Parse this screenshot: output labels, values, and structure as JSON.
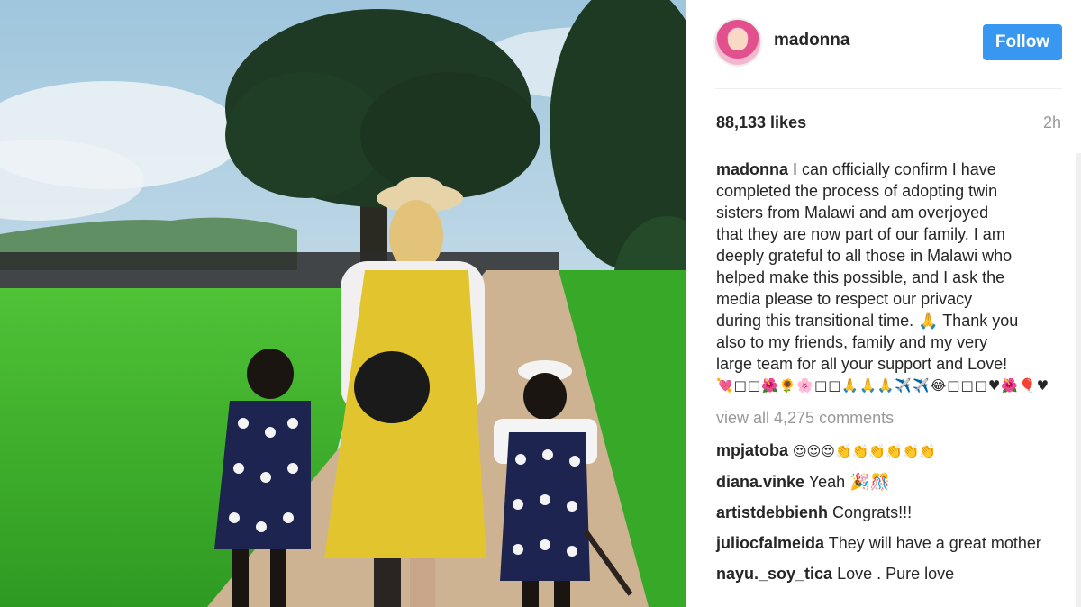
{
  "post": {
    "username": "madonna",
    "follow_label": "Follow",
    "likes": "88,133 likes",
    "time_ago": "2h",
    "caption_user": "madonna",
    "caption_lines": [
      "I can officially confirm I have",
      "completed the process of adopting twin",
      "sisters from Malawi and am overjoyed",
      "that they are now part of our family. I am",
      "deeply grateful to all those in Malawi who",
      "helped make this possible, and I ask the",
      "media please to respect our privacy",
      "during this transitional time. 🙏 Thank you",
      "also to my friends, family and my very",
      "large team for all your support and Love!"
    ],
    "caption_emojis": "💘□□🌺🌻🌸□□🙏🙏🙏✈️✈️😂□□□♥🌺🎈♥",
    "view_all": "view all 4,275 comments"
  },
  "comments": [
    {
      "user": "mpjatoba",
      "text": "😍😍😍👏👏👏👏👏👏"
    },
    {
      "user": "diana.vinke",
      "text": "Yeah 🎉🎊"
    },
    {
      "user": "artistdebbienh",
      "text": "Congrats!!!"
    },
    {
      "user": "juliocfalmeida",
      "text": "They will have a great mother"
    },
    {
      "user": "nayu._soy_tica",
      "text": "Love . Pure love"
    }
  ],
  "colors": {
    "accent": "#3897f0",
    "text": "#262626",
    "muted": "#999999"
  }
}
